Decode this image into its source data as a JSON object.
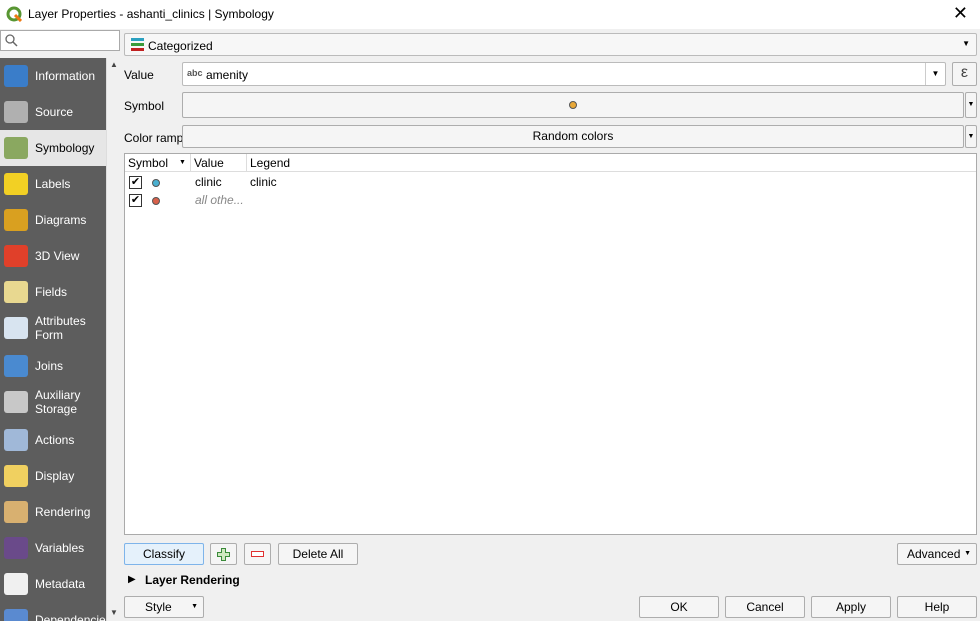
{
  "window": {
    "title": "Layer Properties - ashanti_clinics | Symbology",
    "close": "✕"
  },
  "sidebar": {
    "search_placeholder": "",
    "items": [
      {
        "label": "Information",
        "icon": "info-icon",
        "color": "#3a7dc9"
      },
      {
        "label": "Source",
        "icon": "wrench-gear-icon",
        "color": "#b0b0b0"
      },
      {
        "label": "Symbology",
        "icon": "paintbrush-icon",
        "color": "#8aa860"
      },
      {
        "label": "Labels",
        "icon": "abc-label-icon",
        "color": "#f2d024"
      },
      {
        "label": "Diagrams",
        "icon": "diagram-icon",
        "color": "#d9a020"
      },
      {
        "label": "3D View",
        "icon": "cube-icon",
        "color": "#e0402a"
      },
      {
        "label": "Fields",
        "icon": "fields-icon",
        "color": "#e8d890"
      },
      {
        "label": "Attributes Form",
        "icon": "form-icon",
        "color": "#d8e4f0"
      },
      {
        "label": "Joins",
        "icon": "joins-icon",
        "color": "#4a8ad0"
      },
      {
        "label": "Auxiliary Storage",
        "icon": "database-icon",
        "color": "#c8c8c8"
      },
      {
        "label": "Actions",
        "icon": "actions-gear-icon",
        "color": "#a0b8d8"
      },
      {
        "label": "Display",
        "icon": "speech-bubble-icon",
        "color": "#f0d060"
      },
      {
        "label": "Rendering",
        "icon": "brush-icon",
        "color": "#d8b070"
      },
      {
        "label": "Variables",
        "icon": "epsilon-icon",
        "color": "#6a4a8a"
      },
      {
        "label": "Metadata",
        "icon": "metadata-icon",
        "color": "#f0f0f0"
      },
      {
        "label": "Dependencies",
        "icon": "dependencies-icon",
        "color": "#5a8ad0"
      }
    ],
    "selected": "Symbology"
  },
  "renderer": {
    "type": "Categorized"
  },
  "value": {
    "label": "Value",
    "type_badge": "abc",
    "field": "amenity"
  },
  "symbol": {
    "label": "Symbol",
    "color": "#e8a838"
  },
  "color_ramp": {
    "label": "Color ramp",
    "value": "Random colors"
  },
  "table": {
    "headers": [
      "Symbol",
      "Value",
      "Legend"
    ],
    "rows": [
      {
        "checked": true,
        "color": "#4ab0d0",
        "value": "clinic",
        "legend": "clinic"
      },
      {
        "checked": true,
        "color": "#d8604a",
        "value": "all othe...",
        "legend": ""
      }
    ]
  },
  "buttons": {
    "classify": "Classify",
    "delete_all": "Delete All",
    "advanced": "Advanced",
    "style": "Style",
    "ok": "OK",
    "cancel": "Cancel",
    "apply": "Apply",
    "help": "Help"
  },
  "layer_rendering": "Layer Rendering"
}
